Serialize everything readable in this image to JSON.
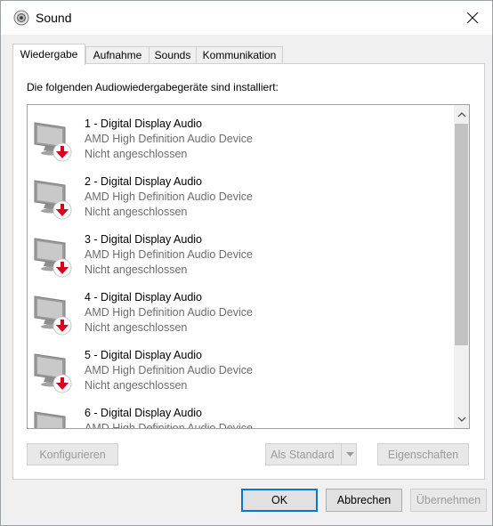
{
  "window": {
    "title": "Sound",
    "icon": "speaker-icon",
    "close_icon": "close-icon"
  },
  "tabs": [
    {
      "label": "Wiedergabe",
      "active": true
    },
    {
      "label": "Aufnahme",
      "active": false
    },
    {
      "label": "Sounds",
      "active": false
    },
    {
      "label": "Kommunikation",
      "active": false
    }
  ],
  "panel": {
    "label": "Die folgenden Audiowiedergabegeräte sind installiert:"
  },
  "devices": [
    {
      "name": "1 - Digital Display Audio",
      "description": "AMD High Definition Audio Device",
      "status": "Nicht angeschlossen"
    },
    {
      "name": "2 - Digital Display Audio",
      "description": "AMD High Definition Audio Device",
      "status": "Nicht angeschlossen"
    },
    {
      "name": "3 - Digital Display Audio",
      "description": "AMD High Definition Audio Device",
      "status": "Nicht angeschlossen"
    },
    {
      "name": "4 - Digital Display Audio",
      "description": "AMD High Definition Audio Device",
      "status": "Nicht angeschlossen"
    },
    {
      "name": "5 - Digital Display Audio",
      "description": "AMD High Definition Audio Device",
      "status": "Nicht angeschlossen"
    },
    {
      "name": "6 - Digital Display Audio",
      "description": "AMD High Definition Audio Device",
      "status": ""
    }
  ],
  "device_icon": "monitor-icon",
  "status_badge_icon": "down-arrow-badge-icon",
  "badge_color": "#d9001b",
  "panel_buttons": {
    "configure": "Konfigurieren",
    "set_default": "Als Standard",
    "properties": "Eigenschaften"
  },
  "dialog_buttons": {
    "ok": "OK",
    "cancel": "Abbrechen",
    "apply": "Übernehmen"
  },
  "colors": {
    "accent": "#0078d7",
    "scroll_thumb": "#c2c2c2"
  }
}
